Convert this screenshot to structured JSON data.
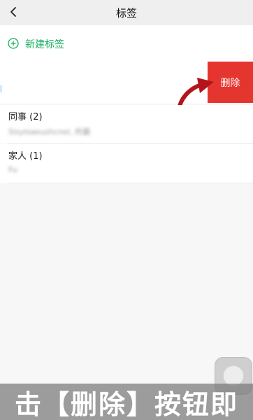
{
  "header": {
    "title": "标签",
    "back_icon": "chevron-left-icon"
  },
  "new_tag": {
    "label": "新建标签",
    "icon": "plus-circle-icon",
    "accent_color": "#1aad5f"
  },
  "swipe": {
    "delete_label": "删除",
    "delete_color": "#e5352f",
    "arrow_icon": "curved-arrow-icon",
    "arrow_color": "#b3151b"
  },
  "groups": [
    {
      "name": "同事 (2)",
      "members": "Sisyloaeushcnel, 所霸"
    },
    {
      "name": "家人 (1)",
      "members": "Fu"
    }
  ],
  "floating_button": {
    "icon": "assistive-touch-icon"
  },
  "caption": {
    "text": "击【删除】按钮即"
  }
}
